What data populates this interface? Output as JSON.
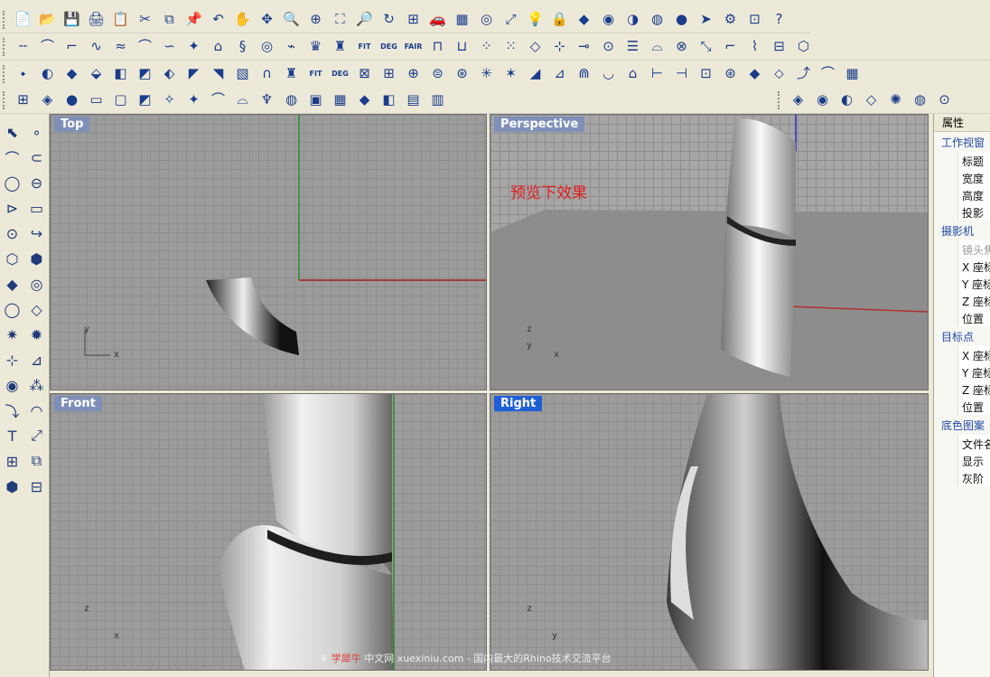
{
  "toolbars": {
    "row1": [
      "📄",
      "📂",
      "💾",
      "🖨",
      "📋",
      "✂",
      "⧉",
      "📌",
      "↶",
      "✋",
      "✥",
      "🔍",
      "⊕",
      "⛶",
      "🔎",
      "↻",
      "⊞",
      "🚗",
      "▦",
      "◎",
      "⤢",
      "💡",
      "🔒",
      "◆",
      "◉",
      "◑",
      "◍",
      "●",
      "➤",
      "⚙",
      "⊡",
      "?"
    ],
    "row2": [
      "╌",
      "⌒",
      "⌐",
      "∿",
      "≈",
      "⌒",
      "∽",
      "✦",
      "⌂",
      "§",
      "◎",
      "⌁",
      "♛",
      "♜",
      "FIT",
      "DEG",
      "FAIR",
      "⊓",
      "⊔",
      "⁘",
      "⁙",
      "◇",
      "⊹",
      "⊸",
      "⊙",
      "☰",
      "⌓",
      "⊗",
      "⤡",
      "⌐",
      "⌇",
      "⊟",
      "⬡"
    ],
    "row3": [
      "⬩",
      "◐",
      "◆",
      "⬙",
      "◧",
      "◩",
      "⬖",
      "◤",
      "◥",
      "▧",
      "∩",
      "♜",
      "FIT",
      "DEG",
      "⊠",
      "⊞",
      "⊕",
      "⊜",
      "⊛",
      "✳",
      "✶",
      "◢",
      "⊿",
      "⋒",
      "◡",
      "⌂",
      "⊢",
      "⊣",
      "⊡",
      "⊛",
      "◆",
      "⬦",
      "⤴",
      "⌒",
      "▦"
    ],
    "row4a": [
      "⊞",
      "◈",
      "●",
      "▭",
      "▢",
      "◩",
      "✧",
      "✦",
      "⌒",
      "⌓",
      "♆",
      "◍",
      "▣",
      "▦",
      "◆",
      "◧",
      "▤",
      "▥"
    ],
    "row4b": [
      "◈",
      "◉",
      "◐",
      "◇",
      "✺",
      "◍",
      "⊙"
    ]
  },
  "leftbar": [
    "⬉",
    "∘",
    "⌒",
    "⊂",
    "◯",
    "⊖",
    "⊳",
    "▭",
    "⊙",
    "↪",
    "⬡",
    "⬢",
    "◆",
    "◎",
    "◯",
    "◇",
    "✷",
    "✹",
    "⊹",
    "⊿",
    "◉",
    "⁂",
    "⤵",
    "◠",
    "T",
    "⤢",
    "⊞",
    "⧉",
    "⬢",
    "⊟"
  ],
  "viewports": {
    "top": {
      "label": "Top",
      "axis_y": "y",
      "axis_x": "x"
    },
    "perspective": {
      "label": "Perspective",
      "annotation": "预览下效果",
      "axis_z": "z",
      "axis_y": "y",
      "axis_x": "x"
    },
    "front": {
      "label": "Front",
      "axis_z": "z",
      "axis_x": "x"
    },
    "right": {
      "label": "Right",
      "axis_z": "z",
      "axis_y": "y"
    }
  },
  "properties": {
    "tab": "属性",
    "sections": [
      {
        "title": "工作视窗",
        "items": [
          "标题",
          "宽度",
          "高度",
          "投影"
        ]
      },
      {
        "title": "摄影机",
        "items": [
          "镜头焦",
          "X 座标",
          "Y 座标",
          "Z 座标",
          "位置"
        ]
      },
      {
        "title": "目标点",
        "items": [
          "X 座标",
          "Y 座标",
          "Z 座标",
          "位置"
        ]
      },
      {
        "title": "底色图案",
        "items": [
          "文件名",
          "显示",
          "灰阶"
        ]
      }
    ]
  },
  "watermark": {
    "brand": "学犀牛",
    "text": "中文网 xuexiniu.com - 国内最大的Rhino技术交流平台"
  }
}
